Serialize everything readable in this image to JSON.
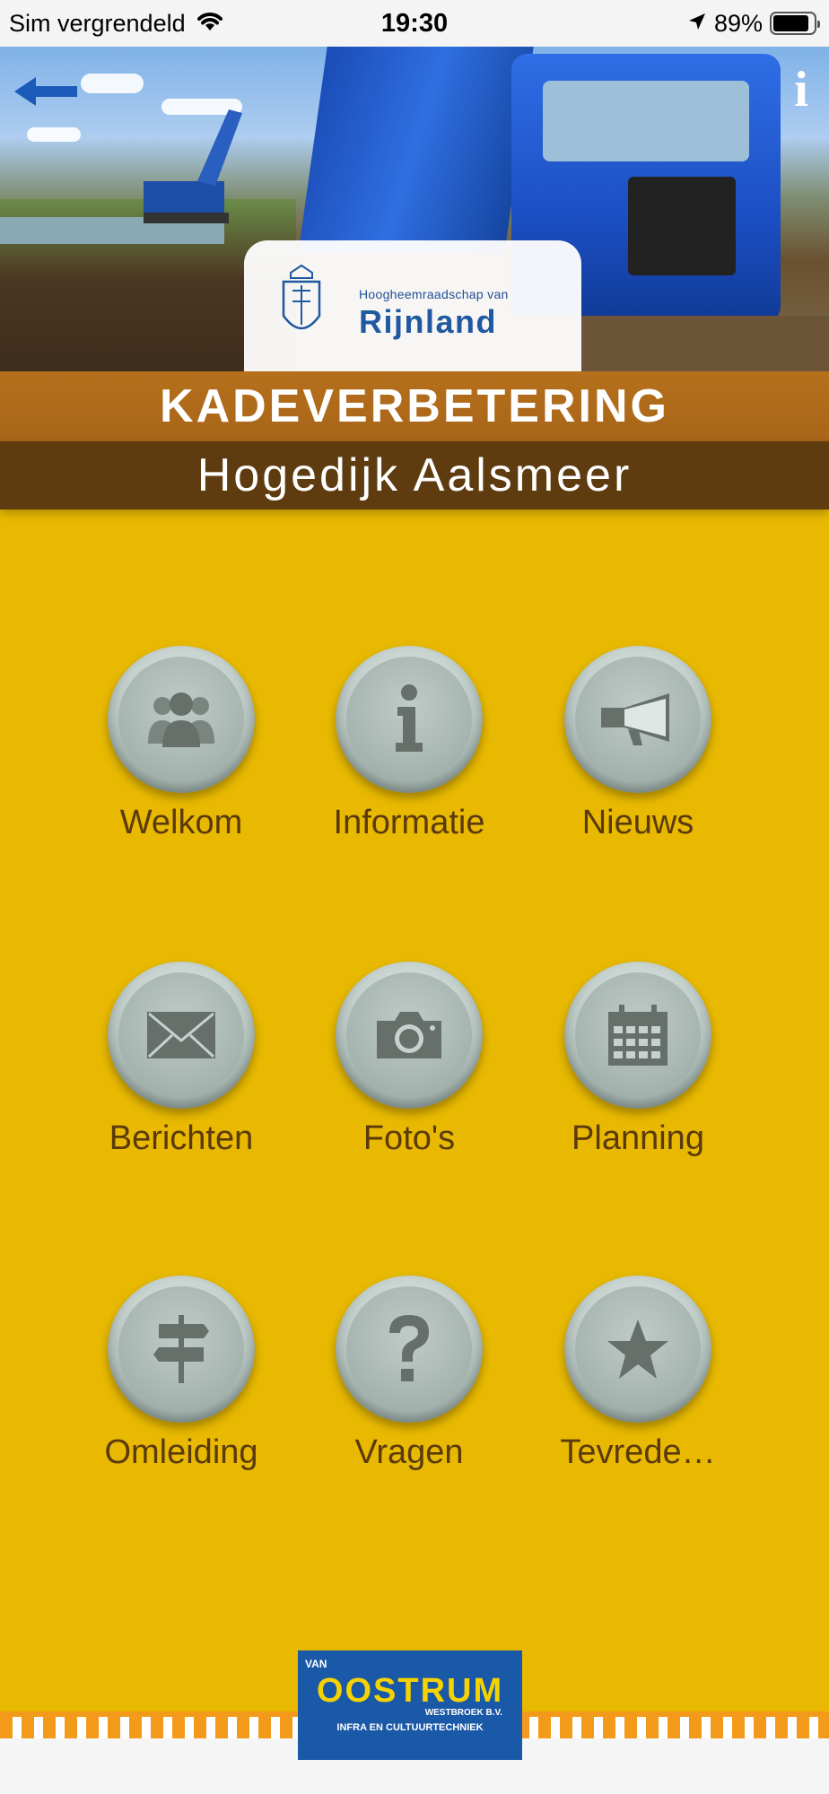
{
  "status_bar": {
    "carrier": "Sim vergrendeld",
    "time": "19:30",
    "battery": "89%",
    "battery_level": 0.89
  },
  "header": {
    "logo_subtitle": "Hoogheemraadschap van",
    "logo_name": "Rijnland",
    "title": "KADEVERBETERING",
    "subtitle": "Hogedijk Aalsmeer"
  },
  "menu": [
    {
      "label": "Welkom",
      "icon": "people-icon"
    },
    {
      "label": "Informatie",
      "icon": "info-icon"
    },
    {
      "label": "Nieuws",
      "icon": "megaphone-icon"
    },
    {
      "label": "Berichten",
      "icon": "envelope-icon"
    },
    {
      "label": "Foto's",
      "icon": "camera-icon"
    },
    {
      "label": "Planning",
      "icon": "calendar-icon"
    },
    {
      "label": "Omleiding",
      "icon": "signpost-icon"
    },
    {
      "label": "Vragen",
      "icon": "question-icon"
    },
    {
      "label": "Tevrede…",
      "icon": "star-icon"
    }
  ],
  "footer": {
    "van": "VAN",
    "brand": "OOSTRUM",
    "location": "WESTBROEK B.V.",
    "tagline": "INFRA EN CULTUURTECHNIEK"
  },
  "colors": {
    "background": "#e8b900",
    "band_top": "#b5701b",
    "band_bottom": "#5e3c10",
    "label": "#5a3a0c",
    "accent_blue": "#1a58a8"
  }
}
